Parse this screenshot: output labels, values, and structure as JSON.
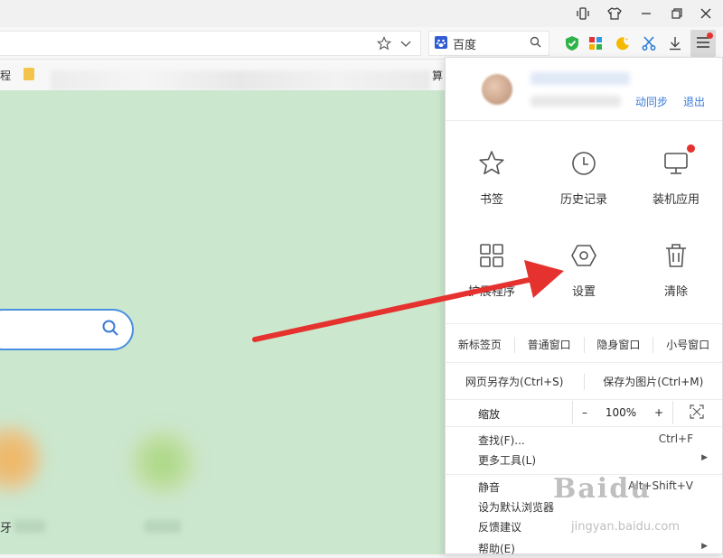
{
  "titlebar": {
    "icons": [
      "vibrate-icon",
      "shirt-icon",
      "minimize-icon",
      "restore-icon",
      "close-icon"
    ]
  },
  "toolbar": {
    "search_engine": "百度",
    "icons": [
      "star-icon",
      "chevron-down-icon",
      "magnifier-icon",
      "shield-icon",
      "apps-icon",
      "moon-icon",
      "scissors-icon",
      "download-icon",
      "menu-icon"
    ]
  },
  "bookmarks": {
    "items": [
      "程",
      "算"
    ]
  },
  "page": {
    "tiles": [
      {
        "label": "虎牙"
      },
      {
        "label": ""
      }
    ]
  },
  "menu": {
    "profile": {
      "sync_label": "动同步",
      "logout_label": "退出"
    },
    "grid": [
      {
        "label": "书签",
        "icon": "star-icon"
      },
      {
        "label": "历史记录",
        "icon": "clock-icon"
      },
      {
        "label": "装机应用",
        "icon": "monitor-icon",
        "badge": true
      },
      {
        "label": "扩展程序",
        "icon": "grid-icon"
      },
      {
        "label": "设置",
        "icon": "hexagon-icon"
      },
      {
        "label": "清除",
        "icon": "trash-icon"
      }
    ],
    "window_row": [
      "新标签页",
      "普通窗口",
      "隐身窗口",
      "小号窗口"
    ],
    "save_row": [
      "网页另存为(Ctrl+S)",
      "保存为图片(Ctrl+M)"
    ],
    "zoom": {
      "label": "缩放",
      "minus": "–",
      "value": "100%",
      "plus": "+"
    },
    "items": [
      {
        "label": "查找(F)...",
        "shortcut": "Ctrl+F"
      },
      {
        "label": "更多工具(L)",
        "submenu": true
      },
      {
        "label": "静音",
        "shortcut": "Alt+Shift+V"
      },
      {
        "label": "设为默认浏览器",
        "shortcut": ""
      },
      {
        "label": "反馈建议",
        "shortcut": ""
      },
      {
        "label": "帮助(E)",
        "submenu": true
      }
    ]
  },
  "watermark": {
    "brand": "Baidu",
    "site": "jingyan.baidu.com"
  },
  "colors": {
    "page_bg": "#cbe7ce",
    "accent_blue": "#3a7bd5",
    "arrow_red": "#e5322f"
  }
}
